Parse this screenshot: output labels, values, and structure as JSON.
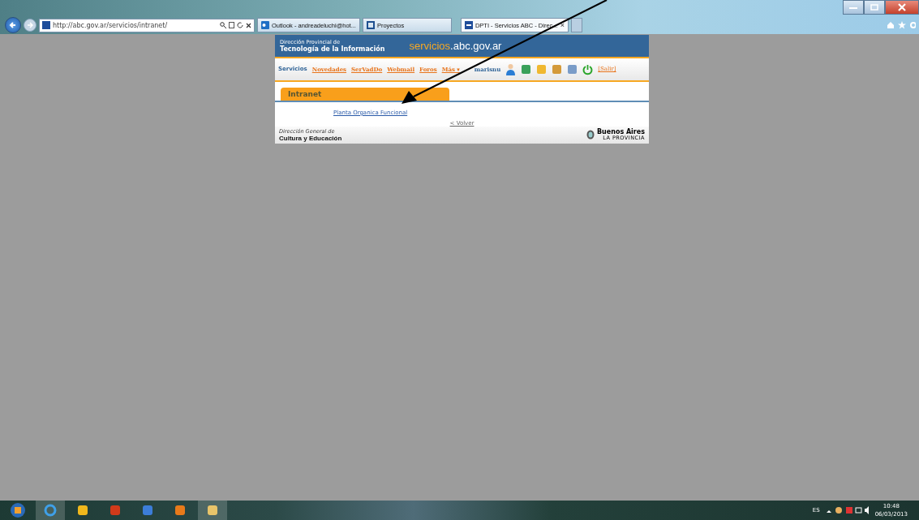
{
  "browser": {
    "address": "http://abc.gov.ar/servicios/intranet/",
    "tabs": [
      {
        "label": "Outlook - andreadeluchi@hot...",
        "selected": false
      },
      {
        "label": "Proyectos",
        "selected": false
      },
      {
        "label": "DPTI - Servicios ABC - Direc...",
        "selected": true,
        "close": "×"
      }
    ]
  },
  "site": {
    "header": {
      "line1": "Dirección Provincial de",
      "line2": "Tecnología de la Información",
      "brand": "servicios",
      "domain": ".abc.gov.ar"
    },
    "nav": {
      "section": "Servicios",
      "links": [
        "Novedades",
        "SerVadDo",
        "Webmail",
        "Foros",
        "Más ▾"
      ],
      "user": "marisnu",
      "logout": "[Salir]"
    },
    "tab": "Intranet",
    "links": [
      "Planta Organica Funcional"
    ],
    "back": "< Volver",
    "footer": {
      "small": "Dirección General de",
      "big": "Cultura y Educación",
      "logo_title": "Buenos Aires",
      "logo_sub": "LA PROVINCIA"
    }
  },
  "taskbar": {
    "lang": "ES",
    "time": "10:48",
    "date": "06/03/2013"
  }
}
